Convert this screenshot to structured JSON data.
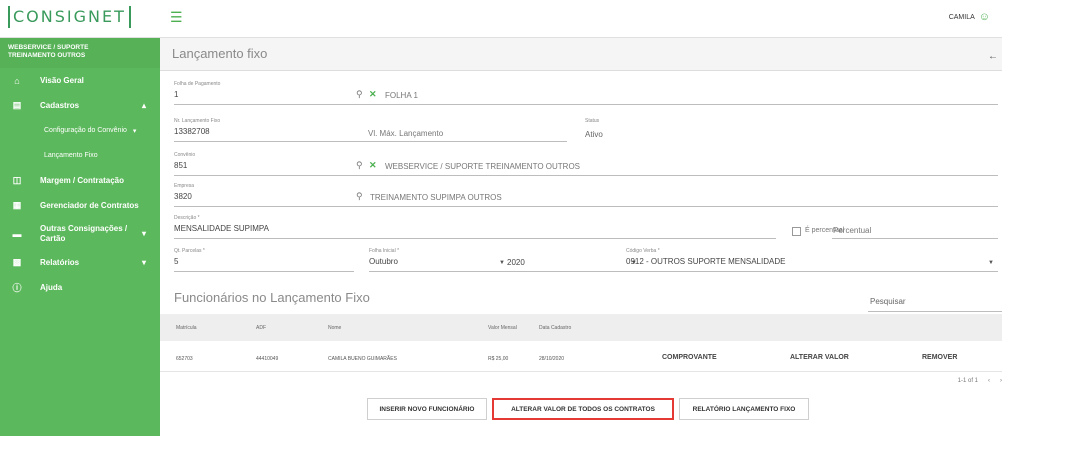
{
  "topbar": {
    "logo": "CONSIGNET",
    "menu_icon": "hamburger-icon",
    "user_name": "CAMILA",
    "user_icon": "user-icon"
  },
  "sidebar": {
    "header_line1": "WEBSERVICE / SUPORTE",
    "header_line2": "TREINAMENTO OUTROS",
    "items": [
      {
        "label": "Visão Geral",
        "icon": "home-icon"
      },
      {
        "label": "Cadastros",
        "icon": "document-icon"
      },
      {
        "label": "Configuração do Convênio"
      },
      {
        "label": "Lançamento Fixo"
      },
      {
        "label": "Margem / Contratação",
        "icon": "money-icon"
      },
      {
        "label": "Gerenciador de Contratos",
        "icon": "contract-icon"
      },
      {
        "label_line1": "Outras Consignações /",
        "label_line2": "Cartão",
        "icon": "card-icon"
      },
      {
        "label": "Relatórios",
        "icon": "report-icon"
      },
      {
        "label": "Ajuda",
        "icon": "help-icon"
      }
    ],
    "color": "#5cb85c"
  },
  "page": {
    "title": "Lançamento fixo"
  },
  "form": {
    "folha_pagamento": {
      "label": "Folha de Pagamento",
      "value": "1",
      "description": "FOLHA 1"
    },
    "nr_lancamento": {
      "label": "Nr. Lançamento Fixo",
      "value": "13382708"
    },
    "vl_max": {
      "placeholder": "Vl. Máx. Lançamento"
    },
    "status": {
      "label": "Status",
      "value": "Ativo"
    },
    "convenio": {
      "label": "Convênio",
      "value": "851",
      "description": "WEBSERVICE / SUPORTE TREINAMENTO OUTROS"
    },
    "empresa": {
      "label": "Empresa",
      "value": "3820",
      "description": "TREINAMENTO SUPIMPA OUTROS"
    },
    "descricao": {
      "label": "Descrição *",
      "value": "MENSALIDADE SUPIMPA"
    },
    "e_percentual": {
      "label": "É percentual"
    },
    "percentual": {
      "placeholder": "Percentual"
    },
    "qt_parcelas": {
      "label": "Qt. Parcelas *",
      "value": "5"
    },
    "folha_inicial": {
      "label": "Folha Inicial *",
      "month": "Outubro",
      "year": "2020"
    },
    "codigo_verba": {
      "label": "Código Verba *",
      "value": "0912 - OUTROS SUPORTE MENSALIDADE"
    }
  },
  "employees": {
    "title": "Funcionários no Lançamento Fixo",
    "search_placeholder": "Pesquisar",
    "columns": [
      "Matrícula",
      "ADF",
      "Nome",
      "Valor Mensal",
      "Data Cadastro"
    ],
    "rows": [
      {
        "matricula": "652703",
        "adf": "44410049",
        "nome": "CAMILA BUENO GUIMARÃES",
        "valor": "R$ 25,00",
        "data": "28/10/2020",
        "actions": [
          "COMPROVANTE",
          "ALTERAR VALOR",
          "REMOVER"
        ]
      }
    ],
    "pagination": {
      "range": "1-1 of 1",
      "prev": "‹",
      "next": "›"
    }
  },
  "buttons": {
    "insert": "INSERIR NOVO FUNCIONÁRIO",
    "alter_all": "ALTERAR VALOR DE TODOS OS CONTRATOS",
    "report": "RELATÓRIO LANÇAMENTO FIXO"
  },
  "colors": {
    "accent": "#4caf50",
    "highlight": "#e53935"
  }
}
